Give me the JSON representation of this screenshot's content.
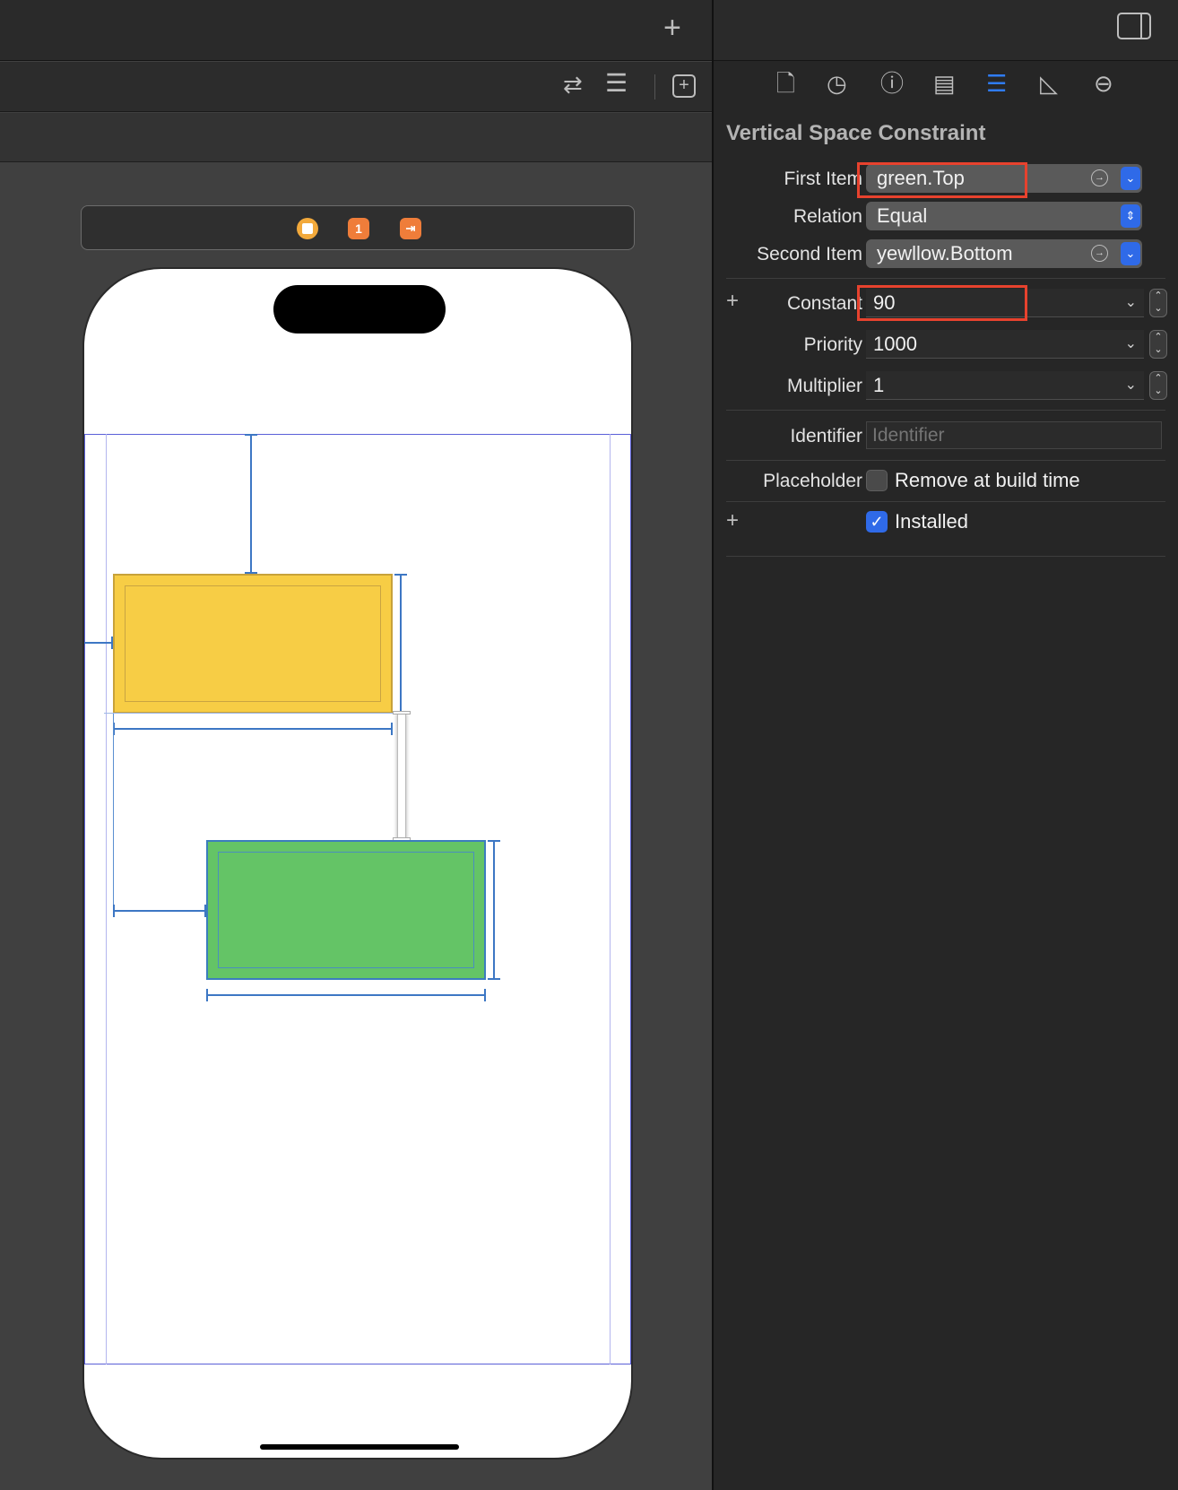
{
  "canvas": {
    "scene_badges": [
      "1"
    ]
  },
  "inspector": {
    "title": "Vertical Space Constraint",
    "first_item": {
      "label": "First Item",
      "value": "green.Top"
    },
    "relation": {
      "label": "Relation",
      "value": "Equal"
    },
    "second_item": {
      "label": "Second Item",
      "value": "yewllow.Bottom"
    },
    "constant": {
      "label": "Constant",
      "value": "90"
    },
    "priority": {
      "label": "Priority",
      "value": "1000"
    },
    "multiplier": {
      "label": "Multiplier",
      "value": "1"
    },
    "identifier": {
      "label": "Identifier",
      "placeholder": "Identifier"
    },
    "placeholder": {
      "label": "Placeholder",
      "checkbox_label": "Remove at build time",
      "checked": false
    },
    "installed": {
      "label": "Installed",
      "checked": true
    }
  },
  "colors": {
    "accent": "#2f6ae8",
    "highlight": "#e7422e",
    "yellow_view": "#f7cd45",
    "green_view": "#64c466",
    "constraint": "#3d77c4"
  }
}
